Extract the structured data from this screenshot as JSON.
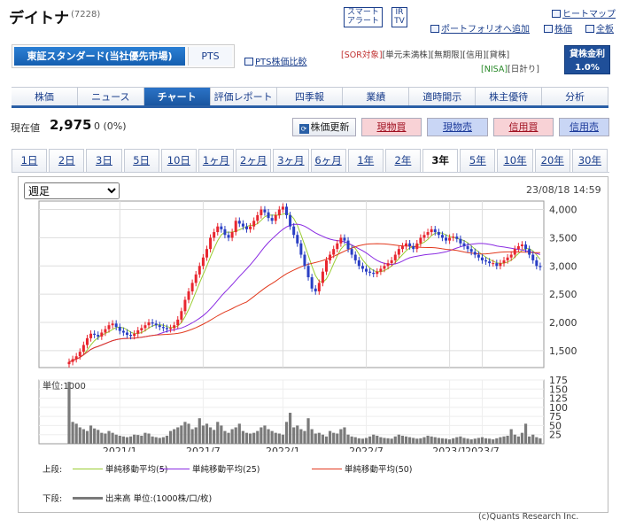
{
  "header": {
    "name": "デイトナ",
    "code": "(7228)",
    "smart_alert": [
      "スマート",
      "アラート"
    ],
    "ir_tv": [
      "IR",
      "TV"
    ],
    "heatmap": "ヒートマップ",
    "add_portfolio": "ポートフォリオへ追加",
    "stock_price": "株価",
    "full_board": "全板"
  },
  "market": {
    "selected": "東証スタンダード(当社優先市場)",
    "other": "PTS",
    "pts_compare": "PTS株価比較"
  },
  "tags": [
    "[SOR対象]",
    "[単元未満株]",
    "[無期限]",
    "[信用]",
    "[貸株]",
    "[NISA]",
    "[日計り]"
  ],
  "lending": {
    "label": "貸株金利",
    "rate": "1.0%"
  },
  "nav": [
    "株価",
    "ニュース",
    "チャート",
    "評価レポート",
    "四季報",
    "業績",
    "適時開示",
    "株主優待",
    "分析"
  ],
  "nav_active": "チャート",
  "price": {
    "label": "現在値",
    "value": "2,975",
    "change": "0 (0%)"
  },
  "actions": {
    "refresh": "株価更新",
    "cash_buy": "現物買",
    "cash_sell": "現物売",
    "margin_buy": "信用買",
    "margin_sell": "信用売"
  },
  "ranges": [
    "1日",
    "2日",
    "3日",
    "5日",
    "10日",
    "1ヶ月",
    "2ヶ月",
    "3ヶ月",
    "6ヶ月",
    "1年",
    "2年",
    "3年",
    "5年",
    "10年",
    "20年",
    "30年"
  ],
  "range_active": "3年",
  "period_select": "週足",
  "timestamp": "23/08/18 14:59",
  "colors": {
    "up": "#e8262f",
    "down": "#2a3fc4",
    "ma5": "#9acd32",
    "ma25": "#8a2be2",
    "ma50": "#e23a1e",
    "volume": "#7a7a7a",
    "nav_active": "#1f63b8"
  },
  "chart_data": {
    "type": "candlestick",
    "price_yaxis": {
      "ticks": [
        "4,000",
        "3,500",
        "3,000",
        "2,500",
        "2,000",
        "1,500"
      ],
      "range": [
        1200,
        4150
      ]
    },
    "volume_yaxis": {
      "ticks": [
        "175",
        "150",
        "125",
        "100",
        "75",
        "50",
        "25"
      ],
      "range": [
        0,
        175
      ],
      "unit_label": "単位:1000"
    },
    "xaxis": {
      "ticks": [
        "2021/1",
        "2021/7",
        "2022/1",
        "2022/7",
        "2023/1",
        "2023/7"
      ]
    },
    "close_weekly": [
      1300,
      1350,
      1400,
      1480,
      1600,
      1720,
      1800,
      1780,
      1750,
      1820,
      1880,
      1950,
      1980,
      1920,
      1850,
      1820,
      1780,
      1760,
      1800,
      1860,
      1900,
      1950,
      2000,
      1980,
      1950,
      1920,
      1900,
      1880,
      1900,
      1950,
      2050,
      2200,
      2400,
      2550,
      2700,
      2850,
      3000,
      3150,
      3300,
      3500,
      3600,
      3700,
      3650,
      3550,
      3500,
      3600,
      3800,
      3750,
      3700,
      3650,
      3700,
      3800,
      3900,
      4000,
      3950,
      3850,
      3800,
      3900,
      4000,
      4050,
      3900,
      3700,
      3550,
      3400,
      3200,
      3000,
      2800,
      2600,
      2550,
      2700,
      2900,
      3100,
      3200,
      3300,
      3400,
      3500,
      3450,
      3300,
      3200,
      3100,
      3000,
      2950,
      2900,
      2880,
      2860,
      2900,
      2950,
      3000,
      3050,
      3100,
      3200,
      3300,
      3350,
      3400,
      3350,
      3300,
      3400,
      3500,
      3550,
      3600,
      3650,
      3600,
      3550,
      3500,
      3450,
      3500,
      3520,
      3480,
      3400,
      3350,
      3300,
      3250,
      3200,
      3150,
      3100,
      3080,
      3050,
      3050,
      3000,
      3050,
      3100,
      3150,
      3200,
      3300,
      3350,
      3380,
      3300,
      3200,
      3100,
      3000,
      2980
    ],
    "volume_weekly": [
      170,
      60,
      55,
      45,
      40,
      35,
      50,
      42,
      38,
      30,
      28,
      35,
      30,
      25,
      22,
      20,
      18,
      20,
      25,
      24,
      22,
      30,
      28,
      20,
      18,
      16,
      18,
      22,
      35,
      40,
      45,
      50,
      60,
      55,
      40,
      45,
      70,
      50,
      55,
      45,
      38,
      60,
      50,
      35,
      30,
      40,
      45,
      55,
      35,
      30,
      28,
      30,
      35,
      45,
      50,
      40,
      35,
      30,
      28,
      25,
      60,
      85,
      45,
      50,
      40,
      35,
      70,
      40,
      28,
      30,
      25,
      20,
      35,
      30,
      28,
      40,
      45,
      25,
      20,
      18,
      15,
      14,
      16,
      20,
      25,
      22,
      18,
      16,
      15,
      14,
      20,
      25,
      22,
      20,
      18,
      16,
      14,
      15,
      18,
      22,
      20,
      18,
      16,
      15,
      14,
      12,
      15,
      18,
      20,
      16,
      14,
      12,
      14,
      16,
      18,
      15,
      14,
      12,
      15,
      18,
      20,
      22,
      40,
      25,
      20,
      30,
      55,
      20,
      25,
      18,
      15
    ],
    "series": [
      {
        "name": "単純移動平均(5)"
      },
      {
        "name": "単純移動平均(25)"
      },
      {
        "name": "単純移動平均(50)"
      },
      {
        "name": "出来高 単位:(1000株/口/枚)"
      }
    ]
  },
  "legend": {
    "upper": "上段:",
    "lower": "下段:"
  },
  "copyright": "(c)Quants Research Inc."
}
